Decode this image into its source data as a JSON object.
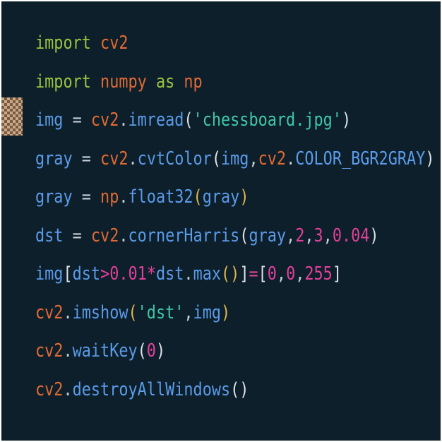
{
  "colors": {
    "background": "#0d1f2a",
    "keyword": "#9bc341",
    "module": "#e16a33",
    "identifier": "#5b9be9",
    "operator": "#c8d0d8",
    "bracket": "#e0b84c",
    "paren": "#dfe4ea",
    "string": "#3fc8a8",
    "number": "#e0419a",
    "constant": "#5b9be9"
  },
  "code": {
    "lines": [
      {
        "tokens": [
          {
            "text": "import",
            "type": "keyword"
          },
          {
            "text": " ",
            "type": "operator"
          },
          {
            "text": "cv2",
            "type": "module"
          }
        ]
      },
      {
        "tokens": [
          {
            "text": "import",
            "type": "keyword"
          },
          {
            "text": " ",
            "type": "operator"
          },
          {
            "text": "numpy",
            "type": "module"
          },
          {
            "text": " ",
            "type": "operator"
          },
          {
            "text": "as",
            "type": "keyword"
          },
          {
            "text": " ",
            "type": "operator"
          },
          {
            "text": "np",
            "type": "module"
          }
        ]
      },
      {
        "tokens": [
          {
            "text": "img",
            "type": "identifier"
          },
          {
            "text": " = ",
            "type": "operator"
          },
          {
            "text": "cv2",
            "type": "module"
          },
          {
            "text": ".",
            "type": "operator"
          },
          {
            "text": "imread",
            "type": "identifier"
          },
          {
            "text": "(",
            "type": "paren"
          },
          {
            "text": "'chessboard.jpg'",
            "type": "string"
          },
          {
            "text": ")",
            "type": "paren"
          }
        ]
      },
      {
        "tokens": [
          {
            "text": "gray",
            "type": "identifier"
          },
          {
            "text": " = ",
            "type": "operator"
          },
          {
            "text": "cv2",
            "type": "module"
          },
          {
            "text": ".",
            "type": "operator"
          },
          {
            "text": "cvtColor",
            "type": "identifier"
          },
          {
            "text": "(",
            "type": "paren"
          },
          {
            "text": "img",
            "type": "identifier"
          },
          {
            "text": ",",
            "type": "operator"
          },
          {
            "text": "cv2",
            "type": "module"
          },
          {
            "text": ".",
            "type": "operator"
          },
          {
            "text": "COLOR_BGR2GRAY",
            "type": "constant"
          },
          {
            "text": ")",
            "type": "paren"
          }
        ]
      },
      {
        "tokens": [
          {
            "text": "gray",
            "type": "identifier"
          },
          {
            "text": " = ",
            "type": "operator"
          },
          {
            "text": "np",
            "type": "module"
          },
          {
            "text": ".",
            "type": "operator"
          },
          {
            "text": "float32",
            "type": "identifier"
          },
          {
            "text": "(",
            "type": "bracket"
          },
          {
            "text": "gray",
            "type": "identifier"
          },
          {
            "text": ")",
            "type": "bracket"
          }
        ]
      },
      {
        "tokens": [
          {
            "text": "dst",
            "type": "identifier"
          },
          {
            "text": " = ",
            "type": "operator"
          },
          {
            "text": "cv2",
            "type": "module"
          },
          {
            "text": ".",
            "type": "operator"
          },
          {
            "text": "cornerHarris",
            "type": "identifier"
          },
          {
            "text": "(",
            "type": "paren"
          },
          {
            "text": "gray",
            "type": "identifier"
          },
          {
            "text": ",",
            "type": "operator"
          },
          {
            "text": "2",
            "type": "number"
          },
          {
            "text": ",",
            "type": "operator"
          },
          {
            "text": "3",
            "type": "number"
          },
          {
            "text": ",",
            "type": "operator"
          },
          {
            "text": "0.04",
            "type": "number"
          },
          {
            "text": ")",
            "type": "paren"
          }
        ]
      },
      {
        "tokens": [
          {
            "text": "img",
            "type": "identifier"
          },
          {
            "text": "[",
            "type": "paren"
          },
          {
            "text": "dst",
            "type": "identifier"
          },
          {
            "text": ">",
            "type": "number"
          },
          {
            "text": "0.01",
            "type": "number"
          },
          {
            "text": "*",
            "type": "number"
          },
          {
            "text": "dst",
            "type": "identifier"
          },
          {
            "text": ".",
            "type": "operator"
          },
          {
            "text": "max",
            "type": "identifier"
          },
          {
            "text": "()",
            "type": "bracket"
          },
          {
            "text": "]",
            "type": "paren"
          },
          {
            "text": "=",
            "type": "number"
          },
          {
            "text": "[",
            "type": "paren"
          },
          {
            "text": "0",
            "type": "number"
          },
          {
            "text": ",",
            "type": "operator"
          },
          {
            "text": "0",
            "type": "number"
          },
          {
            "text": ",",
            "type": "operator"
          },
          {
            "text": "255",
            "type": "number"
          },
          {
            "text": "]",
            "type": "paren"
          }
        ]
      },
      {
        "tokens": [
          {
            "text": "cv2",
            "type": "module"
          },
          {
            "text": ".",
            "type": "operator"
          },
          {
            "text": "imshow",
            "type": "identifier"
          },
          {
            "text": "(",
            "type": "bracket"
          },
          {
            "text": "'dst'",
            "type": "string"
          },
          {
            "text": ",",
            "type": "operator"
          },
          {
            "text": "img",
            "type": "identifier"
          },
          {
            "text": ")",
            "type": "bracket"
          }
        ]
      },
      {
        "tokens": [
          {
            "text": "cv2",
            "type": "module"
          },
          {
            "text": ".",
            "type": "operator"
          },
          {
            "text": "waitKey",
            "type": "identifier"
          },
          {
            "text": "(",
            "type": "paren"
          },
          {
            "text": "0",
            "type": "number"
          },
          {
            "text": ")",
            "type": "paren"
          }
        ]
      },
      {
        "tokens": [
          {
            "text": "cv2",
            "type": "module"
          },
          {
            "text": ".",
            "type": "operator"
          },
          {
            "text": "destroyAllWindows",
            "type": "identifier"
          },
          {
            "text": "()",
            "type": "paren"
          }
        ]
      }
    ]
  }
}
